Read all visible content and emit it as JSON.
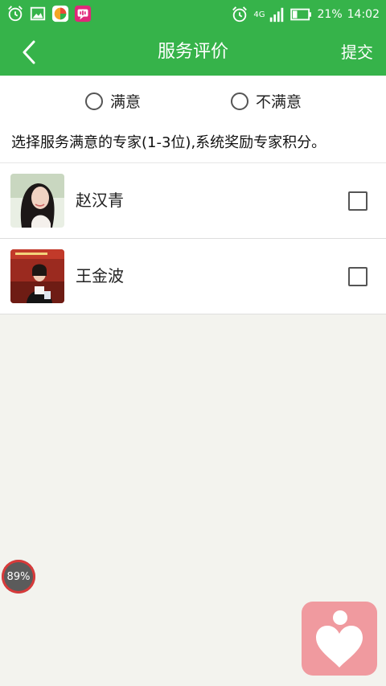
{
  "status_bar": {
    "network_label": "4G",
    "battery_percent": "21%",
    "time": "14:02"
  },
  "header": {
    "title": "服务评价",
    "submit_label": "提交"
  },
  "rating": {
    "options": [
      "满意",
      "不满意"
    ]
  },
  "instruction": "选择服务满意的专家(1-3位),系统奖励专家积分。",
  "experts": [
    {
      "name": "赵汉青",
      "checked": false
    },
    {
      "name": "王金波",
      "checked": false
    }
  ],
  "overlay": {
    "memory_ball_label": "89%"
  },
  "colors": {
    "brand_green": "#36b34a",
    "background": "#f3f3ee",
    "heart_button_bg": "#f09a9f"
  }
}
